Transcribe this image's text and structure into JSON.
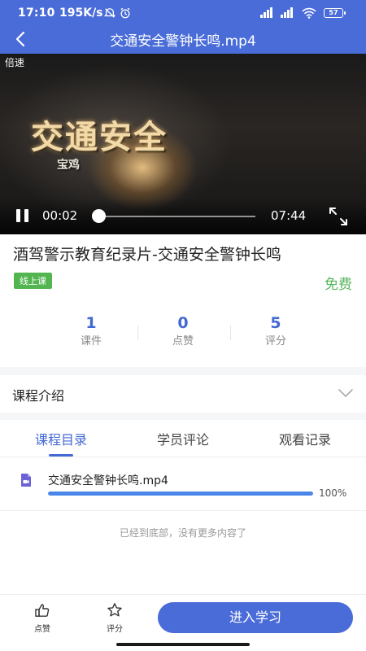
{
  "status_bar": {
    "time": "17:10",
    "network_speed": "195K/s",
    "battery": "57",
    "icons": [
      "alarm-off-icon",
      "alarm-clock-icon",
      "signal-icon",
      "signal-icon",
      "wifi-icon",
      "battery-icon"
    ]
  },
  "header": {
    "title": "交通安全警钟长鸣.mp4",
    "back_icon": "chevron-left-icon"
  },
  "player": {
    "speed_label": "倍速",
    "overlay_title": "交通安全",
    "overlay_subtitle": "宝鸡",
    "current_time": "00:02",
    "duration": "07:44",
    "progress_fraction": 0.004,
    "state": "playing",
    "pause_icon": "pause-icon",
    "fullscreen_icon": "fullscreen-icon"
  },
  "course": {
    "title": "酒驾警示教育纪录片-交通安全警钟长鸣",
    "tag": "线上课",
    "price": "免费",
    "stats": [
      {
        "value": "1",
        "label": "课件"
      },
      {
        "value": "0",
        "label": "点赞"
      },
      {
        "value": "5",
        "label": "评分"
      }
    ]
  },
  "intro": {
    "label": "课程介绍",
    "chevron_icon": "chevron-down-icon"
  },
  "tabs": {
    "items": [
      {
        "label": "课程目录",
        "active": true
      },
      {
        "label": "学员评论",
        "active": false
      },
      {
        "label": "观看记录",
        "active": false
      }
    ]
  },
  "lessons": {
    "items": [
      {
        "name": "交通安全警钟长鸣.mp4",
        "progress_percent": 100,
        "progress_text": "100%",
        "icon": "video-file-icon"
      }
    ],
    "end_text": "已经到底部，没有更多内容了"
  },
  "actions": {
    "like_label": "点赞",
    "like_icon": "thumbs-up-icon",
    "rate_label": "评分",
    "rate_icon": "star-icon",
    "primary_label": "进入学习"
  },
  "colors": {
    "brand": "#4a6cd8",
    "accent_blue": "#4469d4",
    "free_green": "#58b55d",
    "tag_green": "#52b550",
    "progress_blue": "#4a86e8"
  }
}
